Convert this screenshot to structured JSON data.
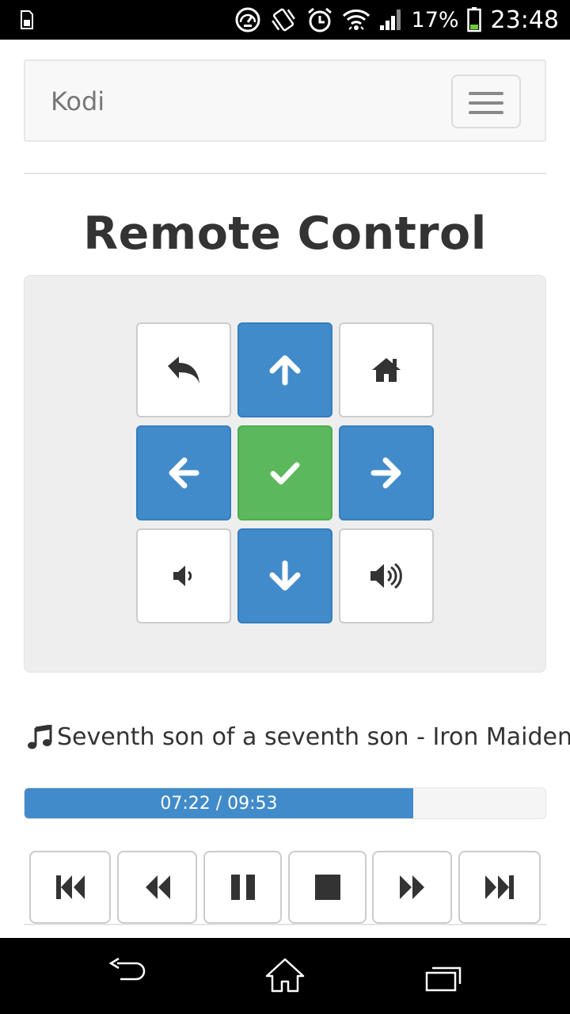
{
  "status_bar": {
    "battery_percent": "17%",
    "clock": "23:48",
    "icons": [
      "sim-icon",
      "speedometer-icon",
      "vibrate-icon",
      "alarm-icon",
      "wifi-icon",
      "signal-icon",
      "battery-icon"
    ]
  },
  "navbar": {
    "brand": "Kodi",
    "menu_icon": "hamburger-icon"
  },
  "page": {
    "title": "Remote Control"
  },
  "remote": {
    "buttons": [
      {
        "name": "back",
        "icon": "back-arrow-icon",
        "style": "white"
      },
      {
        "name": "up",
        "icon": "arrow-up-icon",
        "style": "blue"
      },
      {
        "name": "home",
        "icon": "home-icon",
        "style": "white"
      },
      {
        "name": "left",
        "icon": "arrow-left-icon",
        "style": "blue"
      },
      {
        "name": "select",
        "icon": "checkmark-icon",
        "style": "green"
      },
      {
        "name": "right",
        "icon": "arrow-right-icon",
        "style": "blue"
      },
      {
        "name": "volume-down",
        "icon": "volume-down-icon",
        "style": "white"
      },
      {
        "name": "down",
        "icon": "arrow-down-icon",
        "style": "blue"
      },
      {
        "name": "volume-up",
        "icon": "volume-up-icon",
        "style": "white"
      }
    ]
  },
  "now_playing": {
    "icon": "music-note-icon",
    "text": "Seventh son of a seventh son - Iron Maiden"
  },
  "progress": {
    "label": "07:22 / 09:53",
    "fraction": 0.746
  },
  "transport": [
    {
      "name": "skip-previous",
      "icon": "skip-previous-icon"
    },
    {
      "name": "rewind",
      "icon": "rewind-icon"
    },
    {
      "name": "pause",
      "icon": "pause-icon"
    },
    {
      "name": "stop",
      "icon": "stop-icon"
    },
    {
      "name": "fast-forward",
      "icon": "fast-forward-icon"
    },
    {
      "name": "skip-next",
      "icon": "skip-next-icon"
    }
  ],
  "system_nav": [
    "back-nav-icon",
    "home-nav-icon",
    "recents-nav-icon"
  ],
  "colors": {
    "primary": "#428bca",
    "success": "#5cb85c",
    "well": "#eeeeee"
  }
}
